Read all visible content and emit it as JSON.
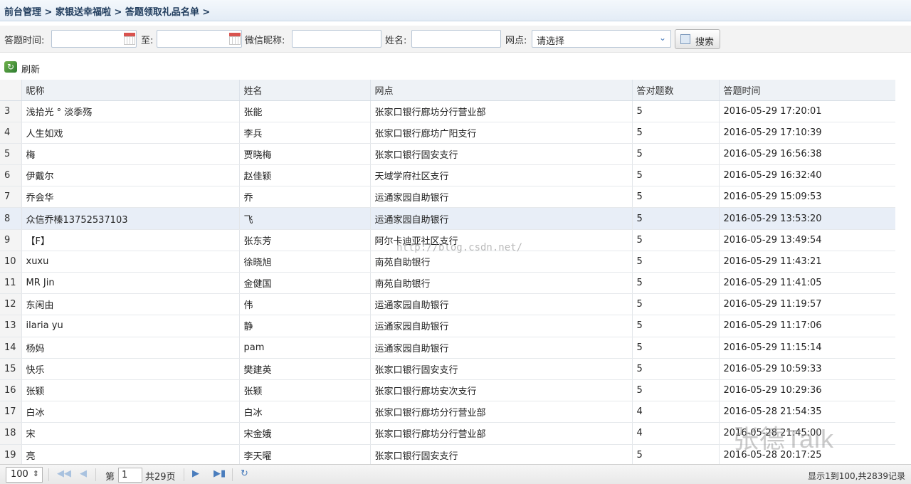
{
  "breadcrumb": "前台管理 > 家银送幸福啦 > 答题领取礼品名单 >",
  "filters": {
    "time_label": "答题时间:",
    "to_label": "至:",
    "nickname_label": "微信昵称:",
    "name_label": "姓名:",
    "branch_label": "网点:",
    "branch_select": "请选择",
    "search_button": "搜索"
  },
  "toolbar": {
    "refresh": "刷新"
  },
  "table": {
    "columns": [
      "昵称",
      "姓名",
      "网点",
      "答对题数",
      "答题时间"
    ],
    "rows": [
      {
        "n": "3",
        "nick": "浅拾光 ° 淡季殇",
        "name": "张能",
        "branch": "张家口银行廊坊分行营业部",
        "score": "5",
        "time": "2016-05-29 17:20:01"
      },
      {
        "n": "4",
        "nick": "人生如戏",
        "name": "李兵",
        "branch": "张家口银行廊坊广阳支行",
        "score": "5",
        "time": "2016-05-29 17:10:39"
      },
      {
        "n": "5",
        "nick": "梅",
        "name": "贾晓梅",
        "branch": "张家口银行固安支行",
        "score": "5",
        "time": "2016-05-29 16:56:38"
      },
      {
        "n": "6",
        "nick": "伊戴尔",
        "name": "赵佳颖",
        "branch": "天域学府社区支行",
        "score": "5",
        "time": "2016-05-29 16:32:40"
      },
      {
        "n": "7",
        "nick": "乔会华",
        "name": "乔",
        "branch": "运通家园自助银行",
        "score": "5",
        "time": "2016-05-29 15:09:53"
      },
      {
        "n": "8",
        "nick": "众信乔榛13752537103",
        "name": "飞",
        "branch": "运通家园自助银行",
        "score": "5",
        "time": "2016-05-29 13:53:20"
      },
      {
        "n": "9",
        "nick": "【F】",
        "name": "张东芳",
        "branch": "阿尔卡迪亚社区支行",
        "score": "5",
        "time": "2016-05-29 13:49:54"
      },
      {
        "n": "10",
        "nick": "xuxu",
        "name": "徐晓旭",
        "branch": "南苑自助银行",
        "score": "5",
        "time": "2016-05-29 11:43:21"
      },
      {
        "n": "11",
        "nick": "MR Jin",
        "name": "金健国",
        "branch": "南苑自助银行",
        "score": "5",
        "time": "2016-05-29 11:41:05"
      },
      {
        "n": "12",
        "nick": "东闲由",
        "name": "伟",
        "branch": "运通家园自助银行",
        "score": "5",
        "time": "2016-05-29 11:19:57"
      },
      {
        "n": "13",
        "nick": "ilaria yu",
        "name": "静",
        "branch": "运通家园自助银行",
        "score": "5",
        "time": "2016-05-29 11:17:06"
      },
      {
        "n": "14",
        "nick": "杨妈",
        "name": "pam",
        "branch": "运通家园自助银行",
        "score": "5",
        "time": "2016-05-29 11:15:14"
      },
      {
        "n": "15",
        "nick": "快乐",
        "name": "樊建英",
        "branch": "张家口银行固安支行",
        "score": "5",
        "time": "2016-05-29 10:59:33"
      },
      {
        "n": "16",
        "nick": "张颖",
        "name": "张颖",
        "branch": "张家口银行廊坊安次支行",
        "score": "5",
        "time": "2016-05-29 10:29:36"
      },
      {
        "n": "17",
        "nick": "白冰",
        "name": "白冰",
        "branch": "张家口银行廊坊分行营业部",
        "score": "4",
        "time": "2016-05-28 21:54:35"
      },
      {
        "n": "18",
        "nick": "宋",
        "name": "宋金娥",
        "branch": "张家口银行廊坊分行营业部",
        "score": "4",
        "time": "2016-05-28 21:45:00"
      },
      {
        "n": "19",
        "nick": "亮",
        "name": "李天曜",
        "branch": "张家口银行固安支行",
        "score": "5",
        "time": "2016-05-28 20:17:25"
      }
    ]
  },
  "selected_row": "8",
  "pager": {
    "page_size": "100",
    "page_prefix": "第",
    "page_value": "1",
    "page_total": "共29页",
    "info": "显示1到100,共2839记录"
  },
  "watermark": "http://blog.csdn.net/",
  "logo_watermark": "张德Talk",
  "colors": {
    "header_bg": "#eef2f6",
    "selected_row": "#e8eef7",
    "accent": "#4a7dbd"
  }
}
